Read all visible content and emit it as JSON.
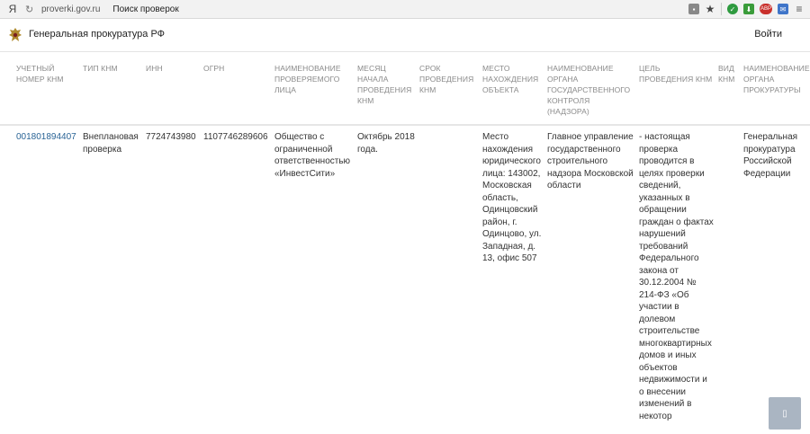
{
  "browser": {
    "logo": "Я",
    "url": "proverki.gov.ru",
    "page_title": "Поиск проверок",
    "abp": "ABP"
  },
  "header": {
    "site_title": "Генеральная прокуратура РФ",
    "login": "Войти"
  },
  "table": {
    "columns": [
      "УЧЕТНЫЙ НОМЕР КНМ",
      "ТИП КНМ",
      "ИНН",
      "ОГРН",
      "НАИМЕНОВАНИЕ ПРОВЕРЯЕМОГО ЛИЦА",
      "МЕСЯЦ НАЧАЛА ПРОВЕДЕНИЯ КНМ",
      "СРОК ПРОВЕДЕНИЯ КНМ",
      "МЕСТО НАХОЖДЕНИЯ ОБЪЕКТА",
      "НАИМЕНОВАНИЕ ОРГАНА ГОСУДАРСТВЕННОГО КОНТРОЛЯ (НАДЗОРА)",
      "ЦЕЛЬ ПРОВЕДЕНИЯ КНМ",
      "ВИД КНМ",
      "НАИМЕНОВАНИЕ ОРГАНА ПРОКУРАТУРЫ"
    ],
    "row": {
      "number": "001801894407",
      "type": "Внеплановая проверка",
      "inn": "7724743980",
      "ogrn": "1107746289606",
      "name": "Общество с ограниченной ответственностью «ИнвестСити»",
      "month": "Октябрь 2018 года.",
      "duration": "",
      "location": "Место нахождения юридического лица: 143002, Московская область, Одинцовский район, г. Одинцово, ул. Западная, д. 13, офис 507",
      "authority": "Главное управление государственного строительного надзора Московской области",
      "purpose": "- настоящая проверка проводится в целях проверки сведений, указанных в обращении граждан о фактах нарушений требований Федерального закона от 30.12.2004 № 214-ФЗ «Об участии в долевом строительстве многоквартирных домов и иных объектов недвижимости и о внесении изменений в некотор",
      "kind": "",
      "prosecutor": "Генеральная прокуратура Российской Федерации"
    }
  }
}
